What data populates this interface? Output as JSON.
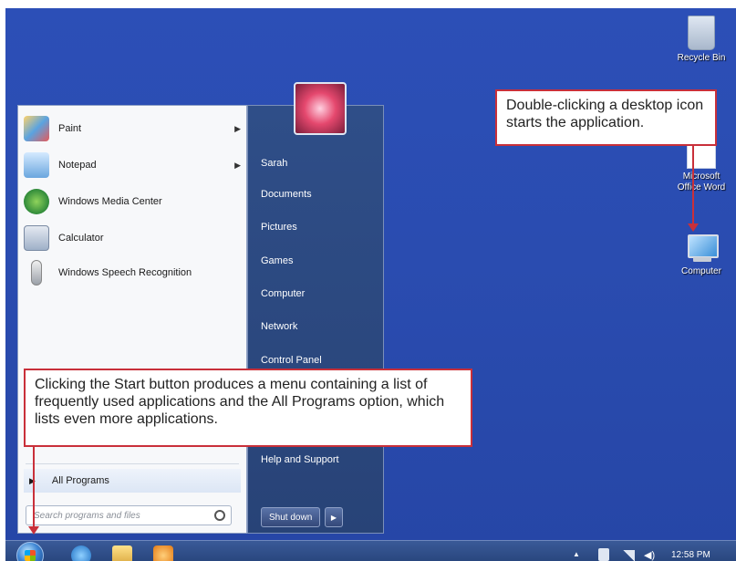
{
  "desktop": {
    "icons": [
      {
        "label": "Recycle Bin",
        "icon": "recycle-bin-icon"
      },
      {
        "label": "Microsoft Office Word",
        "icon": "word-icon"
      },
      {
        "label": "Computer",
        "icon": "computer-icon"
      }
    ]
  },
  "callouts": {
    "desktop_icon": "Double-clicking a desktop icon starts the application.",
    "start_button": "Clicking the Start button produces a menu containing a list of frequently used applications and the All Programs option, which lists even more applications."
  },
  "start_menu": {
    "programs": [
      {
        "label": "Paint",
        "icon": "paint-icon",
        "has_submenu": true
      },
      {
        "label": "Notepad",
        "icon": "notepad-icon",
        "has_submenu": true
      },
      {
        "label": "Windows Media Center",
        "icon": "media-center-icon",
        "has_submenu": false
      },
      {
        "label": "Calculator",
        "icon": "calculator-icon",
        "has_submenu": false
      },
      {
        "label": "Windows Speech Recognition",
        "icon": "microphone-icon",
        "has_submenu": false
      }
    ],
    "all_programs": "All Programs",
    "search_placeholder": "Search programs and files",
    "right_items": [
      "Sarah",
      "Documents",
      "Pictures",
      "Games",
      "Computer",
      "Network",
      "Control Panel",
      "Help and Support"
    ],
    "shutdown_label": "Shut down"
  },
  "taskbar": {
    "clock": "12:58 PM"
  },
  "colors": {
    "desktop": "#2a4cb0",
    "callout_border": "#c9303a"
  }
}
